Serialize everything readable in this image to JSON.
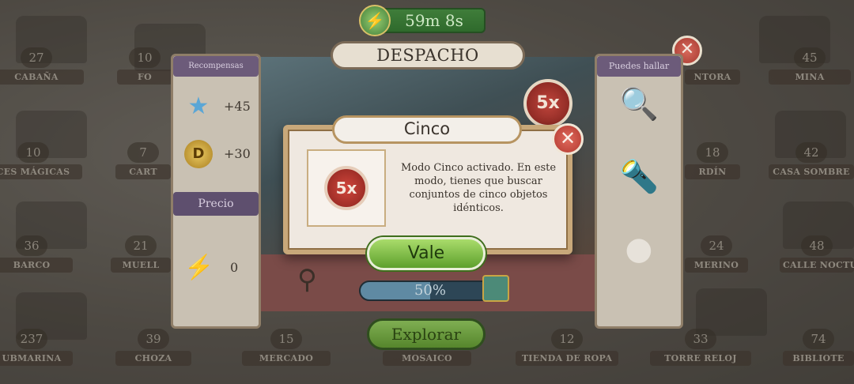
{
  "timer": {
    "label": "59m 8s"
  },
  "scene": {
    "title": "DESPACHO",
    "multiplier": "5x",
    "progress_label": "50%",
    "progress": 0.5
  },
  "left_panel": {
    "rewards_tab": "Recompensas",
    "rewards": [
      {
        "icon": "star-icon",
        "value": "+45"
      },
      {
        "icon": "coin-icon",
        "value": "+30"
      }
    ],
    "price_tab": "Precio",
    "price": {
      "icon": "energy-icon",
      "value": "0"
    }
  },
  "right_panel": {
    "tab": "Puedes hallar",
    "items": [
      "magnifier-key-icon",
      "torch-icon",
      "yarn-ball-icon"
    ]
  },
  "explore_button": "Explorar",
  "modal": {
    "title": "Cinco",
    "badge": "5x",
    "text": "Modo Cinco activado. En este modo, tienes que buscar conjuntos de cinco objetos idénticos.",
    "ok_button": "Vale"
  },
  "locations": [
    {
      "num": "27",
      "name": "CABAÑA"
    },
    {
      "num": "10",
      "name": "FO"
    },
    {
      "num": "",
      "name": "NTORA"
    },
    {
      "num": "45",
      "name": "MINA"
    },
    {
      "num": "10",
      "name": "CES MÁGICAS"
    },
    {
      "num": "7",
      "name": "CART"
    },
    {
      "num": "18",
      "name": "RDÍN"
    },
    {
      "num": "42",
      "name": "CASA SOMBRE"
    },
    {
      "num": "36",
      "name": "BARCO"
    },
    {
      "num": "21",
      "name": "MUELL"
    },
    {
      "num": "24",
      "name": "MERINO"
    },
    {
      "num": "48",
      "name": "CALLE NOCTU"
    },
    {
      "num": "237",
      "name": "UBMARINA"
    },
    {
      "num": "39",
      "name": "CHOZA"
    },
    {
      "num": "15",
      "name": "MERCADO"
    },
    {
      "num": "",
      "name": "MOSAICO"
    },
    {
      "num": "12",
      "name": "TIENDA DE ROPA"
    },
    {
      "num": "33",
      "name": "TORRE RELOJ"
    },
    {
      "num": "74",
      "name": "BIBLIOTE"
    }
  ]
}
